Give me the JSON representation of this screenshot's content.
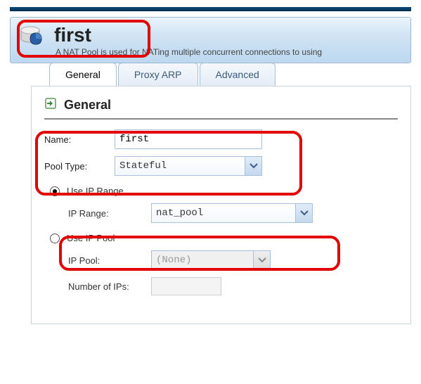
{
  "header": {
    "title": "first",
    "description": "A NAT Pool is used for NATing multiple concurrent connections to using"
  },
  "tabs": {
    "general": "General",
    "proxy_arp": "Proxy ARP",
    "advanced": "Advanced",
    "active": "general"
  },
  "section": {
    "heading": "General"
  },
  "form": {
    "name_label": "Name:",
    "name_value": "first",
    "pool_type_label": "Pool Type:",
    "pool_type_value": "Stateful",
    "use_ip_range_label": "Use IP Range",
    "use_ip_pool_label": "Use IP Pool",
    "selected_option": "range",
    "ip_range_label": "IP Range:",
    "ip_range_value": "nat_pool",
    "ip_pool_label": "IP Pool:",
    "ip_pool_value": "(None)",
    "num_ips_label": "Number of IPs:",
    "num_ips_value": ""
  }
}
